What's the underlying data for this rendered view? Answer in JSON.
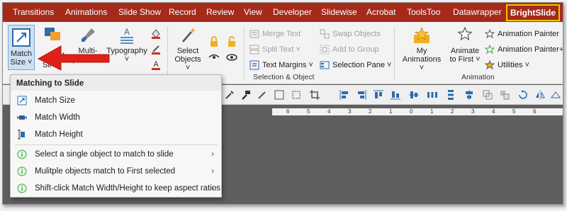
{
  "tabs": [
    "Transitions",
    "Animations",
    "Slide Show",
    "Record",
    "Review",
    "View",
    "Developer",
    "Slidewise",
    "Acrobat",
    "ToolsToo",
    "Datawrapper",
    "BrightSlide"
  ],
  "ribbon": {
    "match_size_label": "Match\nSize ˅",
    "match_partial_label": "M",
    "slides_partial_label": "Sli",
    "multi_painter_label": "Multi-\npainter ˅",
    "typography_label": "Typography\n˅",
    "select_objects_label": "Select\nObjects ˅",
    "merge_text": "Merge Text",
    "split_text": "Split Text ˅",
    "text_margins": "Text Margins ˅",
    "swap_objects": "Swap Objects",
    "add_to_group": "Add to Group",
    "selection_pane": "Selection Pane ˅",
    "group_selection_object": "Selection & Object",
    "my_animations_label": "My\nAnimations ˅",
    "animate_first_label": "Animate\nto First ˅",
    "animation_painter": "Animation Painter",
    "animation_painter_plus": "Animation Painter+",
    "utilities": "Utilities ˅",
    "group_animation": "Animation"
  },
  "ruler_ticks": [
    "6",
    "5",
    "4",
    "3",
    "2",
    "1",
    "0",
    "1",
    "2",
    "3",
    "4",
    "5",
    "6"
  ],
  "menu": {
    "header": "Matching to Slide",
    "items": [
      {
        "label": "Match Size",
        "icon": "match-size-icon"
      },
      {
        "label": "Match Width",
        "icon": "match-width-icon"
      },
      {
        "label": "Match Height",
        "icon": "match-height-icon"
      }
    ],
    "info_items": [
      {
        "label": "Select a single object to match to slide",
        "icon": "info-icon"
      },
      {
        "label": "Mulitple objects match to First selected",
        "icon": "info-icon"
      },
      {
        "label": "Shift-click Match Width/Height to keep aspect ratios",
        "icon": "info-icon"
      }
    ]
  },
  "colors": {
    "tabbar": "#a52a1a",
    "highlight_border": "#f0c800",
    "arrow": "#e0201a",
    "info_green": "#3aa535",
    "icon_blue": "#2b6cb0"
  }
}
